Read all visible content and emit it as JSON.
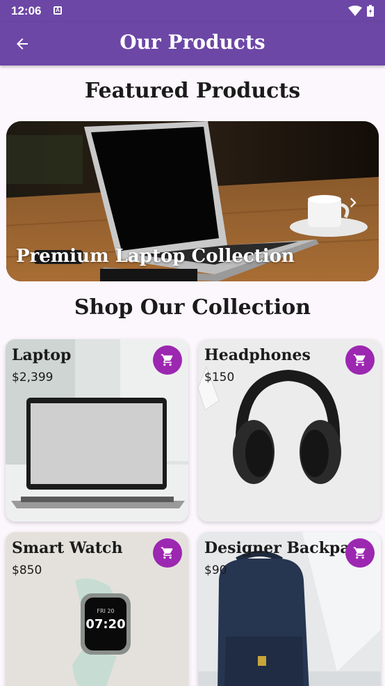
{
  "status_bar": {
    "time": "12:06",
    "notification": "A"
  },
  "app_bar": {
    "title": "Our Products",
    "back_icon": "arrow-left-icon"
  },
  "featured": {
    "heading": "Featured Products",
    "slide_caption": "Premium Laptop Collection",
    "next_icon": "chevron-right-icon"
  },
  "collection": {
    "heading": "Shop Our Collection",
    "products": [
      {
        "name": "Laptop",
        "price": "$2,399"
      },
      {
        "name": "Headphones",
        "price": "$150"
      },
      {
        "name": "Smart Watch",
        "price": "$850"
      },
      {
        "name": "Designer Backpack",
        "price": "$90"
      }
    ],
    "cart_icon": "shopping-cart-icon"
  },
  "watch_face": {
    "day": "FRI 20",
    "time": "07:20"
  },
  "colors": {
    "app_bar": "#6c47a6",
    "cart_button": "#9c27b0",
    "background": "#fcf6fd"
  }
}
